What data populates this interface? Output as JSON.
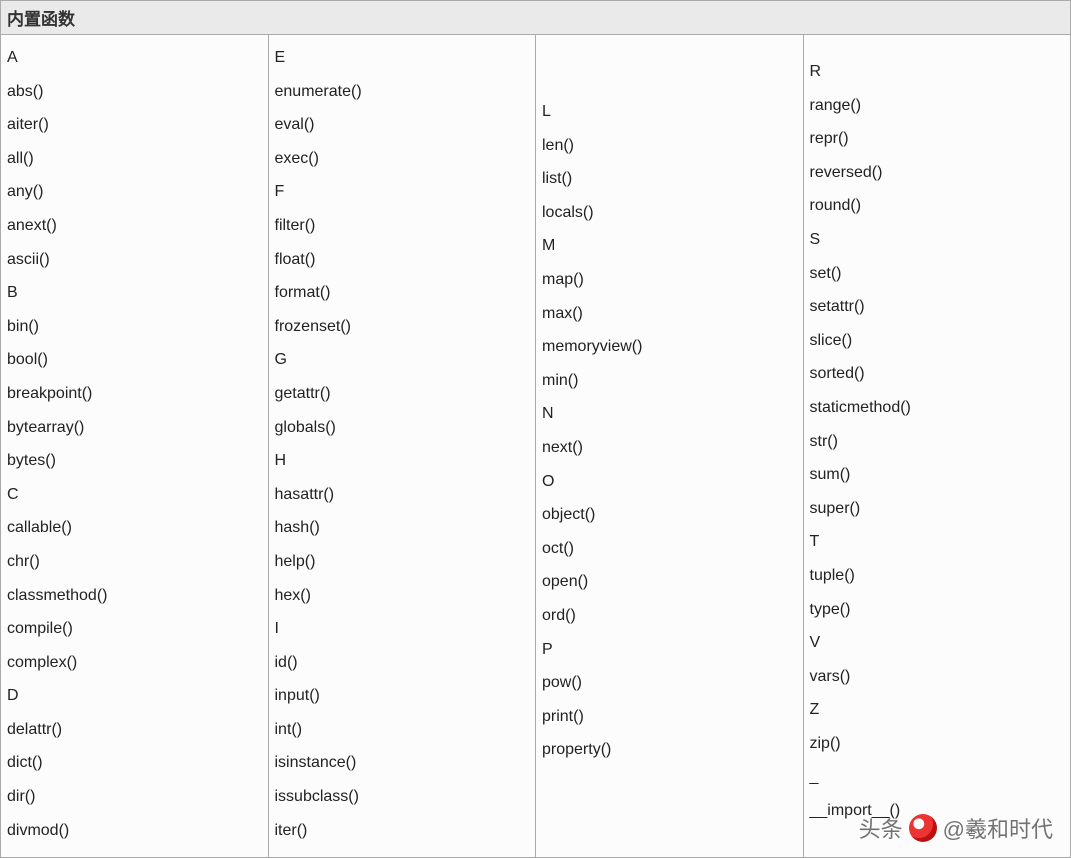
{
  "title": "内置函数",
  "watermark": {
    "prefix": "头条",
    "suffix": "@羲和时代"
  },
  "columns": [
    [
      {
        "t": "letter",
        "v": "A"
      },
      {
        "t": "fn",
        "v": "abs()"
      },
      {
        "t": "fn",
        "v": "aiter()"
      },
      {
        "t": "fn",
        "v": "all()"
      },
      {
        "t": "fn",
        "v": "any()"
      },
      {
        "t": "fn",
        "v": "anext()"
      },
      {
        "t": "fn",
        "v": "ascii()"
      },
      {
        "t": "letter",
        "v": "B"
      },
      {
        "t": "fn",
        "v": "bin()"
      },
      {
        "t": "fn",
        "v": "bool()"
      },
      {
        "t": "fn",
        "v": "breakpoint()"
      },
      {
        "t": "fn",
        "v": "bytearray()"
      },
      {
        "t": "fn",
        "v": "bytes()"
      },
      {
        "t": "letter",
        "v": "C"
      },
      {
        "t": "fn",
        "v": "callable()"
      },
      {
        "t": "fn",
        "v": "chr()"
      },
      {
        "t": "fn",
        "v": "classmethod()"
      },
      {
        "t": "fn",
        "v": "compile()"
      },
      {
        "t": "fn",
        "v": "complex()"
      },
      {
        "t": "letter",
        "v": "D"
      },
      {
        "t": "fn",
        "v": "delattr()"
      },
      {
        "t": "fn",
        "v": "dict()"
      },
      {
        "t": "fn",
        "v": "dir()"
      },
      {
        "t": "fn",
        "v": "divmod()"
      }
    ],
    [
      {
        "t": "letter",
        "v": "E"
      },
      {
        "t": "fn",
        "v": "enumerate()"
      },
      {
        "t": "fn",
        "v": "eval()"
      },
      {
        "t": "fn",
        "v": "exec()"
      },
      {
        "t": "letter",
        "v": "F"
      },
      {
        "t": "fn",
        "v": "filter()"
      },
      {
        "t": "fn",
        "v": "float()"
      },
      {
        "t": "fn",
        "v": "format()"
      },
      {
        "t": "fn",
        "v": "frozenset()"
      },
      {
        "t": "letter",
        "v": "G"
      },
      {
        "t": "fn",
        "v": "getattr()"
      },
      {
        "t": "fn",
        "v": "globals()"
      },
      {
        "t": "letter",
        "v": "H"
      },
      {
        "t": "fn",
        "v": "hasattr()"
      },
      {
        "t": "fn",
        "v": "hash()"
      },
      {
        "t": "fn",
        "v": "help()"
      },
      {
        "t": "fn",
        "v": "hex()"
      },
      {
        "t": "letter",
        "v": "I"
      },
      {
        "t": "fn",
        "v": "id()"
      },
      {
        "t": "fn",
        "v": "input()"
      },
      {
        "t": "fn",
        "v": "int()"
      },
      {
        "t": "fn",
        "v": "isinstance()"
      },
      {
        "t": "fn",
        "v": "issubclass()"
      },
      {
        "t": "fn",
        "v": "iter()"
      }
    ],
    [
      {
        "t": "letter",
        "v": "L"
      },
      {
        "t": "fn",
        "v": "len()"
      },
      {
        "t": "fn",
        "v": "list()"
      },
      {
        "t": "fn",
        "v": "locals()"
      },
      {
        "t": "letter",
        "v": "M"
      },
      {
        "t": "fn",
        "v": "map()"
      },
      {
        "t": "fn",
        "v": "max()"
      },
      {
        "t": "fn",
        "v": "memoryview()"
      },
      {
        "t": "fn",
        "v": "min()"
      },
      {
        "t": "letter",
        "v": "N"
      },
      {
        "t": "fn",
        "v": "next()"
      },
      {
        "t": "letter",
        "v": "O"
      },
      {
        "t": "fn",
        "v": "object()"
      },
      {
        "t": "fn",
        "v": "oct()"
      },
      {
        "t": "fn",
        "v": "open()"
      },
      {
        "t": "fn",
        "v": "ord()"
      },
      {
        "t": "letter",
        "v": "P"
      },
      {
        "t": "fn",
        "v": "pow()"
      },
      {
        "t": "fn",
        "v": "print()"
      },
      {
        "t": "fn",
        "v": "property()"
      }
    ],
    [
      {
        "t": "letter",
        "v": "R"
      },
      {
        "t": "fn",
        "v": "range()"
      },
      {
        "t": "fn",
        "v": "repr()"
      },
      {
        "t": "fn",
        "v": "reversed()"
      },
      {
        "t": "fn",
        "v": "round()"
      },
      {
        "t": "letter",
        "v": "S"
      },
      {
        "t": "fn",
        "v": "set()"
      },
      {
        "t": "fn",
        "v": "setattr()"
      },
      {
        "t": "fn",
        "v": "slice()"
      },
      {
        "t": "fn",
        "v": "sorted()"
      },
      {
        "t": "fn",
        "v": "staticmethod()"
      },
      {
        "t": "fn",
        "v": "str()"
      },
      {
        "t": "fn",
        "v": "sum()"
      },
      {
        "t": "fn",
        "v": "super()"
      },
      {
        "t": "letter",
        "v": "T"
      },
      {
        "t": "fn",
        "v": "tuple()"
      },
      {
        "t": "fn",
        "v": "type()"
      },
      {
        "t": "letter",
        "v": "V"
      },
      {
        "t": "fn",
        "v": "vars()"
      },
      {
        "t": "letter",
        "v": "Z"
      },
      {
        "t": "fn",
        "v": "zip()"
      },
      {
        "t": "letter",
        "v": "_"
      },
      {
        "t": "fn",
        "v": "__import__()"
      }
    ]
  ]
}
